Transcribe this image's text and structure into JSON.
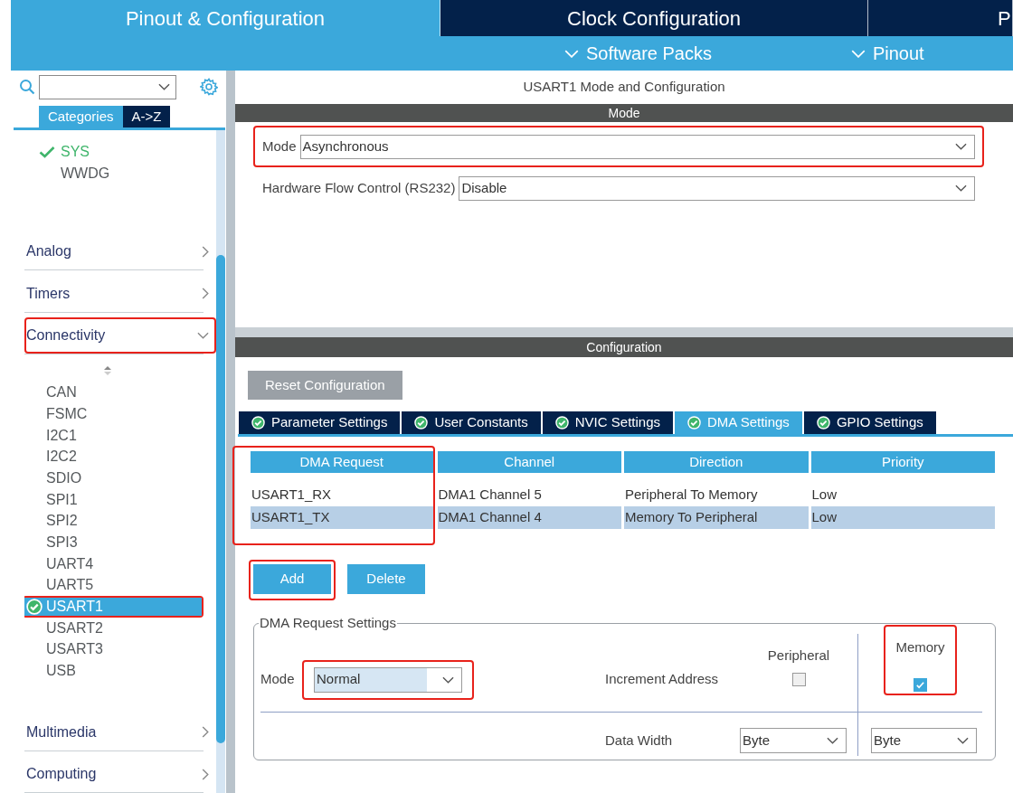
{
  "top_tabs": [
    {
      "label": "Pinout & Configuration",
      "selected": true
    },
    {
      "label": "Clock Configuration",
      "selected": false
    },
    {
      "label": "P",
      "selected": false
    }
  ],
  "menus": [
    {
      "label": "Software Packs"
    },
    {
      "label": "Pinout"
    }
  ],
  "sidebar": {
    "view_tabs": [
      {
        "label": "Categories",
        "selected": true
      },
      {
        "label": "A->Z",
        "selected": false
      }
    ],
    "system_items": [
      {
        "label": "SYS",
        "checked": true
      },
      {
        "label": "WWDG",
        "checked": false
      }
    ],
    "categories": [
      {
        "label": "Analog",
        "expanded": false,
        "highlighted": false
      },
      {
        "label": "Timers",
        "expanded": false,
        "highlighted": false
      },
      {
        "label": "Connectivity",
        "expanded": true,
        "highlighted": true,
        "children": [
          {
            "label": "CAN",
            "configured": false,
            "selected": false,
            "highlighted": false
          },
          {
            "label": "FSMC",
            "configured": false,
            "selected": false,
            "highlighted": false
          },
          {
            "label": "I2C1",
            "configured": false,
            "selected": false,
            "highlighted": false
          },
          {
            "label": "I2C2",
            "configured": false,
            "selected": false,
            "highlighted": false
          },
          {
            "label": "SDIO",
            "configured": false,
            "selected": false,
            "highlighted": false
          },
          {
            "label": "SPI1",
            "configured": false,
            "selected": false,
            "highlighted": false
          },
          {
            "label": "SPI2",
            "configured": false,
            "selected": false,
            "highlighted": false
          },
          {
            "label": "SPI3",
            "configured": false,
            "selected": false,
            "highlighted": false
          },
          {
            "label": "UART4",
            "configured": false,
            "selected": false,
            "highlighted": false
          },
          {
            "label": "UART5",
            "configured": false,
            "selected": false,
            "highlighted": false
          },
          {
            "label": "USART1",
            "configured": true,
            "selected": true,
            "highlighted": true
          },
          {
            "label": "USART2",
            "configured": false,
            "selected": false,
            "highlighted": false
          },
          {
            "label": "USART3",
            "configured": false,
            "selected": false,
            "highlighted": false
          },
          {
            "label": "USB",
            "configured": false,
            "selected": false,
            "highlighted": false
          }
        ]
      },
      {
        "label": "Multimedia",
        "expanded": false,
        "highlighted": false
      },
      {
        "label": "Computing",
        "expanded": false,
        "highlighted": false
      }
    ]
  },
  "panel_title": "USART1 Mode and Configuration",
  "mode_section": {
    "header": "Mode",
    "fields": [
      {
        "label": "Mode",
        "value": "Asynchronous",
        "highlighted": true
      },
      {
        "label": "Hardware Flow Control (RS232)",
        "value": "Disable",
        "highlighted": false
      }
    ]
  },
  "configuration": {
    "header": "Configuration",
    "reset_button": "Reset Configuration",
    "tabs": [
      {
        "label": "Parameter Settings",
        "selected": false
      },
      {
        "label": "User Constants",
        "selected": false
      },
      {
        "label": "NVIC Settings",
        "selected": false
      },
      {
        "label": "DMA Settings",
        "selected": true
      },
      {
        "label": "GPIO Settings",
        "selected": false
      }
    ],
    "dma_table": {
      "columns": [
        "DMA Request",
        "Channel",
        "Direction",
        "Priority"
      ],
      "first_column_highlighted": true,
      "rows": [
        {
          "cells": [
            "USART1_RX",
            "DMA1 Channel 5",
            "Peripheral To Memory",
            "Low"
          ],
          "selected": false
        },
        {
          "cells": [
            "USART1_TX",
            "DMA1 Channel 4",
            "Memory To Peripheral",
            "Low"
          ],
          "selected": true
        }
      ]
    },
    "buttons": [
      {
        "label": "Add",
        "highlighted": true
      },
      {
        "label": "Delete",
        "highlighted": false
      }
    ],
    "settings": {
      "legend": "DMA Request Settings",
      "mode": {
        "label": "Mode",
        "value": "Normal",
        "highlighted": true
      },
      "peripheral_header": "Peripheral",
      "memory_header": "Memory",
      "memory_highlighted": true,
      "increment": {
        "label": "Increment Address",
        "peripheral_checked": false,
        "memory_checked": true
      },
      "data_width": {
        "label": "Data Width",
        "peripheral": "Byte",
        "memory": "Byte"
      }
    }
  }
}
